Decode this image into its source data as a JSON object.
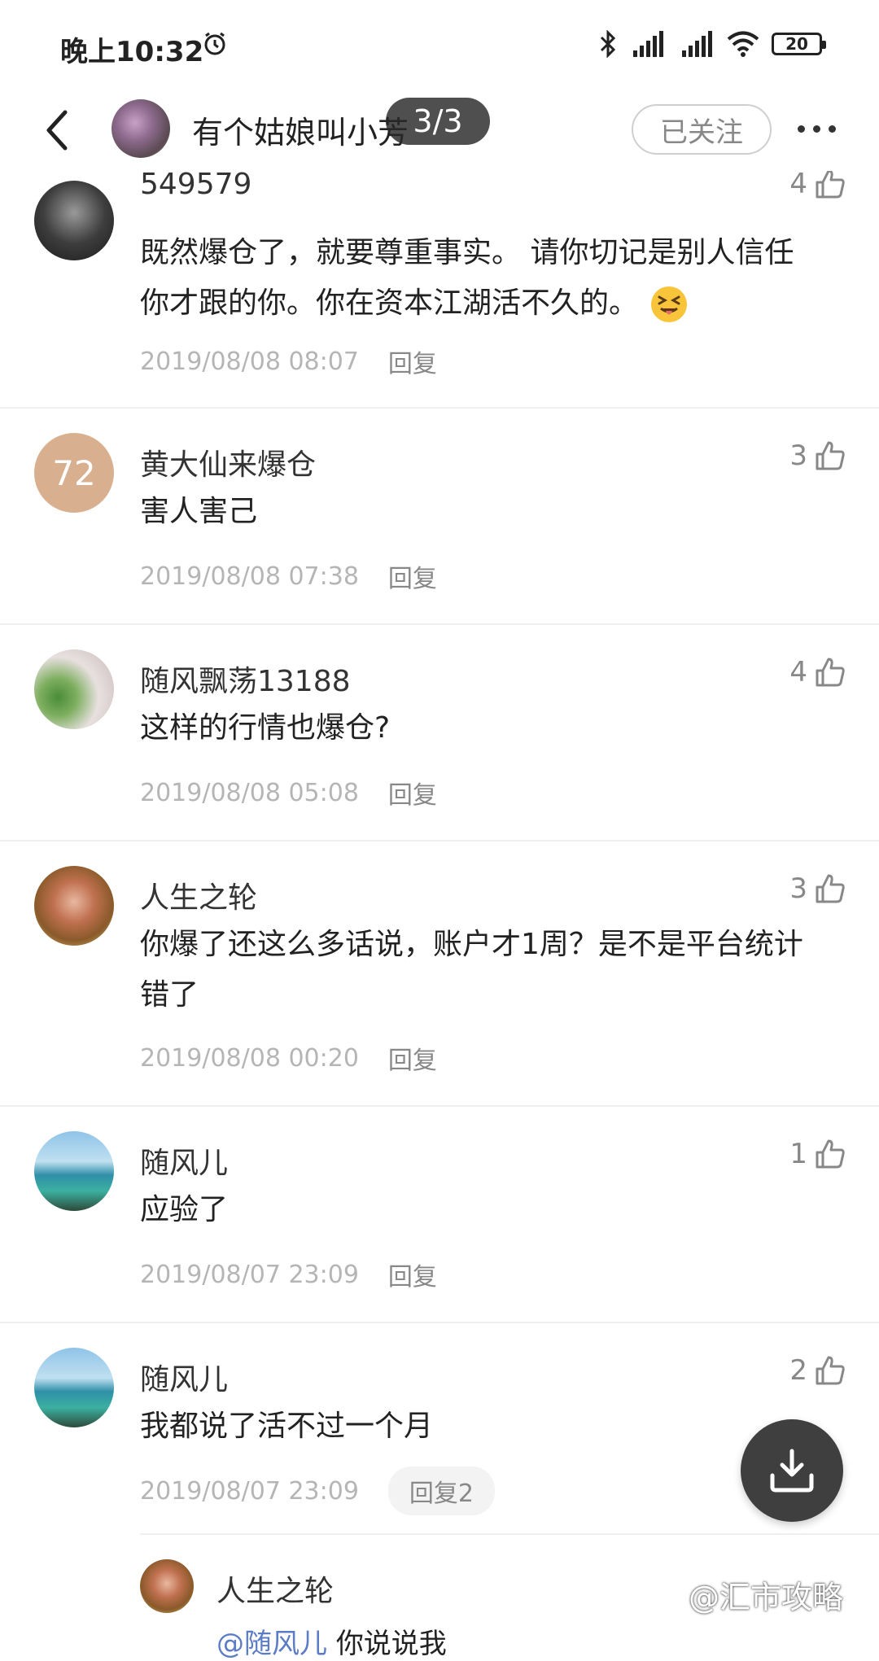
{
  "status_bar": {
    "time": "晚上10:32",
    "battery": "20"
  },
  "header": {
    "title": "有个姑娘叫小芳",
    "page_indicator": "3/3",
    "follow_label": "已关注"
  },
  "comments": [
    {
      "name": "549579",
      "likes": "4",
      "text_lines": [
        "既然爆仓了，就要尊重事实。 请你切记是别人信任",
        "你才跟的你。你在资本江湖活不久的。"
      ],
      "time": "2019/08/08 08:07",
      "reply": "回复"
    },
    {
      "name": "黄大仙来爆仓",
      "avatar_text": "72",
      "likes": "3",
      "text_lines": [
        "害人害己"
      ],
      "time": "2019/08/08 07:38",
      "reply": "回复"
    },
    {
      "name": "随风飘荡13188",
      "likes": "4",
      "text_lines": [
        "这样的行情也爆仓?"
      ],
      "time": "2019/08/08 05:08",
      "reply": "回复"
    },
    {
      "name": "人生之轮",
      "likes": "3",
      "text_lines": [
        "你爆了还这么多话说，账户才1周？是不是平台统计",
        "错了"
      ],
      "time": "2019/08/08 00:20",
      "reply": "回复"
    },
    {
      "name": "随风儿",
      "likes": "1",
      "text_lines": [
        "应验了"
      ],
      "time": "2019/08/07 23:09",
      "reply": "回复"
    },
    {
      "name": "随风儿",
      "likes": "2",
      "text_lines": [
        "我都说了活不过一个月"
      ],
      "time": "2019/08/07 23:09",
      "reply": "回复2"
    }
  ],
  "sub_reply": {
    "name": "人生之轮",
    "mention": "@随风儿",
    "text": "你说说我"
  },
  "watermark": "@汇市攻略",
  "colors": {
    "meta_gray": "#b5b5b5",
    "fab_bg": "#3f3f3f",
    "avatar_72": "#d9b08f"
  }
}
